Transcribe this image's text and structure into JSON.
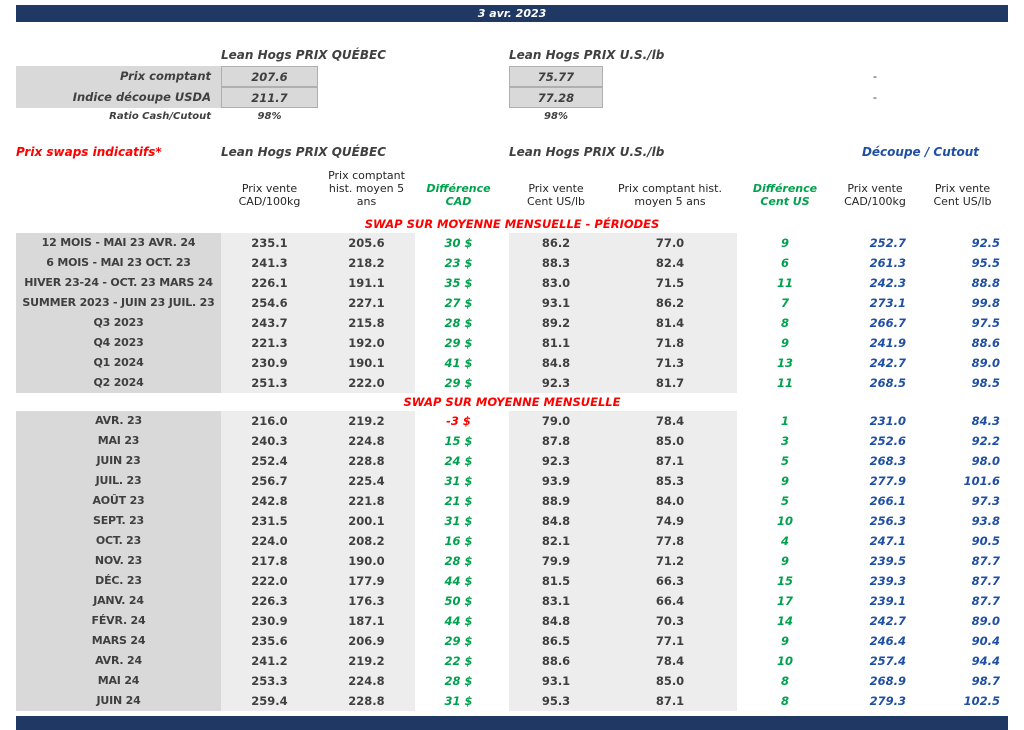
{
  "header": {
    "date": "3 avr. 2023"
  },
  "spot": {
    "quebec_title": "Lean Hogs PRIX QUÉBEC",
    "us_title": "Lean Hogs PRIX U.S./lb",
    "rows": [
      {
        "label": "Prix comptant",
        "quebec": "207.6",
        "us": "75.77",
        "cutout": "-",
        "small": false
      },
      {
        "label": "Indice découpe USDA",
        "quebec": "211.7",
        "us": "77.28",
        "cutout": "-",
        "small": false
      },
      {
        "label": "Ratio Cash/Cutout",
        "quebec": "98%",
        "us": "98%",
        "cutout": "",
        "small": true
      }
    ]
  },
  "swaps": {
    "title": "Prix swaps indicatifs*",
    "quebec_title": "Lean Hogs PRIX QUÉBEC",
    "us_title": "Lean Hogs PRIX U.S./lb",
    "cutout_title": "Découpe / Cutout",
    "columns": [
      "Prix vente\nCAD/100kg",
      "Prix comptant\nhist. moyen 5\nans",
      "Différence\nCAD",
      "Prix vente\nCent US/lb",
      "Prix comptant hist.\nmoyen 5 ans",
      "Différence\nCent US",
      "Prix vente\nCAD/100kg",
      "Prix vente\nCent US/lb"
    ],
    "periods_title": "SWAP SUR MOYENNE MENSUELLE - PÉRIODES",
    "periods": [
      {
        "label": "12 MOIS - MAI 23 AVR. 24",
        "cells": [
          "235.1",
          "205.6",
          "30 $",
          "86.2",
          "77.0",
          "9",
          "252.7",
          "92.5"
        ]
      },
      {
        "label": "6 MOIS - MAI 23 OCT. 23",
        "cells": [
          "241.3",
          "218.2",
          "23 $",
          "88.3",
          "82.4",
          "6",
          "261.3",
          "95.5"
        ]
      },
      {
        "label": "HIVER 23-24 -  OCT. 23 MARS 24",
        "cells": [
          "226.1",
          "191.1",
          "35 $",
          "83.0",
          "71.5",
          "11",
          "242.3",
          "88.8"
        ]
      },
      {
        "label": "SUMMER 2023 - JUIN 23 JUIL. 23",
        "cells": [
          "254.6",
          "227.1",
          "27 $",
          "93.1",
          "86.2",
          "7",
          "273.1",
          "99.8"
        ]
      },
      {
        "label": "Q3 2023",
        "cells": [
          "243.7",
          "215.8",
          "28 $",
          "89.2",
          "81.4",
          "8",
          "266.7",
          "97.5"
        ]
      },
      {
        "label": "Q4 2023",
        "cells": [
          "221.3",
          "192.0",
          "29 $",
          "81.1",
          "71.8",
          "9",
          "241.9",
          "88.6"
        ]
      },
      {
        "label": "Q1 2024",
        "cells": [
          "230.9",
          "190.1",
          "41 $",
          "84.8",
          "71.3",
          "13",
          "242.7",
          "89.0"
        ]
      },
      {
        "label": "Q2 2024",
        "cells": [
          "251.3",
          "222.0",
          "29 $",
          "92.3",
          "81.7",
          "11",
          "268.5",
          "98.5"
        ]
      }
    ],
    "monthly_title": "SWAP SUR MOYENNE MENSUELLE",
    "monthly": [
      {
        "label": "AVR. 23",
        "cells": [
          "216.0",
          "219.2",
          "-3 $",
          "79.0",
          "78.4",
          "1",
          "231.0",
          "84.3"
        ]
      },
      {
        "label": "MAI 23",
        "cells": [
          "240.3",
          "224.8",
          "15 $",
          "87.8",
          "85.0",
          "3",
          "252.6",
          "92.2"
        ]
      },
      {
        "label": "JUIN 23",
        "cells": [
          "252.4",
          "228.8",
          "24 $",
          "92.3",
          "87.1",
          "5",
          "268.3",
          "98.0"
        ]
      },
      {
        "label": "JUIL. 23",
        "cells": [
          "256.7",
          "225.4",
          "31 $",
          "93.9",
          "85.3",
          "9",
          "277.9",
          "101.6"
        ]
      },
      {
        "label": "AOÛT 23",
        "cells": [
          "242.8",
          "221.8",
          "21 $",
          "88.9",
          "84.0",
          "5",
          "266.1",
          "97.3"
        ]
      },
      {
        "label": "SEPT. 23",
        "cells": [
          "231.5",
          "200.1",
          "31 $",
          "84.8",
          "74.9",
          "10",
          "256.3",
          "93.8"
        ]
      },
      {
        "label": "OCT. 23",
        "cells": [
          "224.0",
          "208.2",
          "16 $",
          "82.1",
          "77.8",
          "4",
          "247.1",
          "90.5"
        ]
      },
      {
        "label": "NOV. 23",
        "cells": [
          "217.8",
          "190.0",
          "28 $",
          "79.9",
          "71.2",
          "9",
          "239.5",
          "87.7"
        ]
      },
      {
        "label": "DÉC. 23",
        "cells": [
          "222.0",
          "177.9",
          "44 $",
          "81.5",
          "66.3",
          "15",
          "239.3",
          "87.7"
        ]
      },
      {
        "label": "JANV. 24",
        "cells": [
          "226.3",
          "176.3",
          "50 $",
          "83.1",
          "66.4",
          "17",
          "239.1",
          "87.7"
        ]
      },
      {
        "label": "FÉVR. 24",
        "cells": [
          "230.9",
          "187.1",
          "44 $",
          "84.8",
          "70.3",
          "14",
          "242.7",
          "89.0"
        ]
      },
      {
        "label": "MARS 24",
        "cells": [
          "235.6",
          "206.9",
          "29 $",
          "86.5",
          "77.1",
          "9",
          "246.4",
          "90.4"
        ]
      },
      {
        "label": "AVR. 24",
        "cells": [
          "241.2",
          "219.2",
          "22 $",
          "88.6",
          "78.4",
          "10",
          "257.4",
          "94.4"
        ]
      },
      {
        "label": "MAI 24",
        "cells": [
          "253.3",
          "224.8",
          "28 $",
          "93.1",
          "85.0",
          "8",
          "268.9",
          "98.7"
        ]
      },
      {
        "label": "JUIN 24",
        "cells": [
          "259.4",
          "228.8",
          "31 $",
          "95.3",
          "87.1",
          "8",
          "279.3",
          "102.5"
        ]
      }
    ]
  },
  "colors": {
    "navy": "#1F3864",
    "red": "#FF0000",
    "green": "#00A24D",
    "blue": "#1F4FA3",
    "label_gray": "#D9D9D9",
    "band_gray": "#EDEDED"
  }
}
